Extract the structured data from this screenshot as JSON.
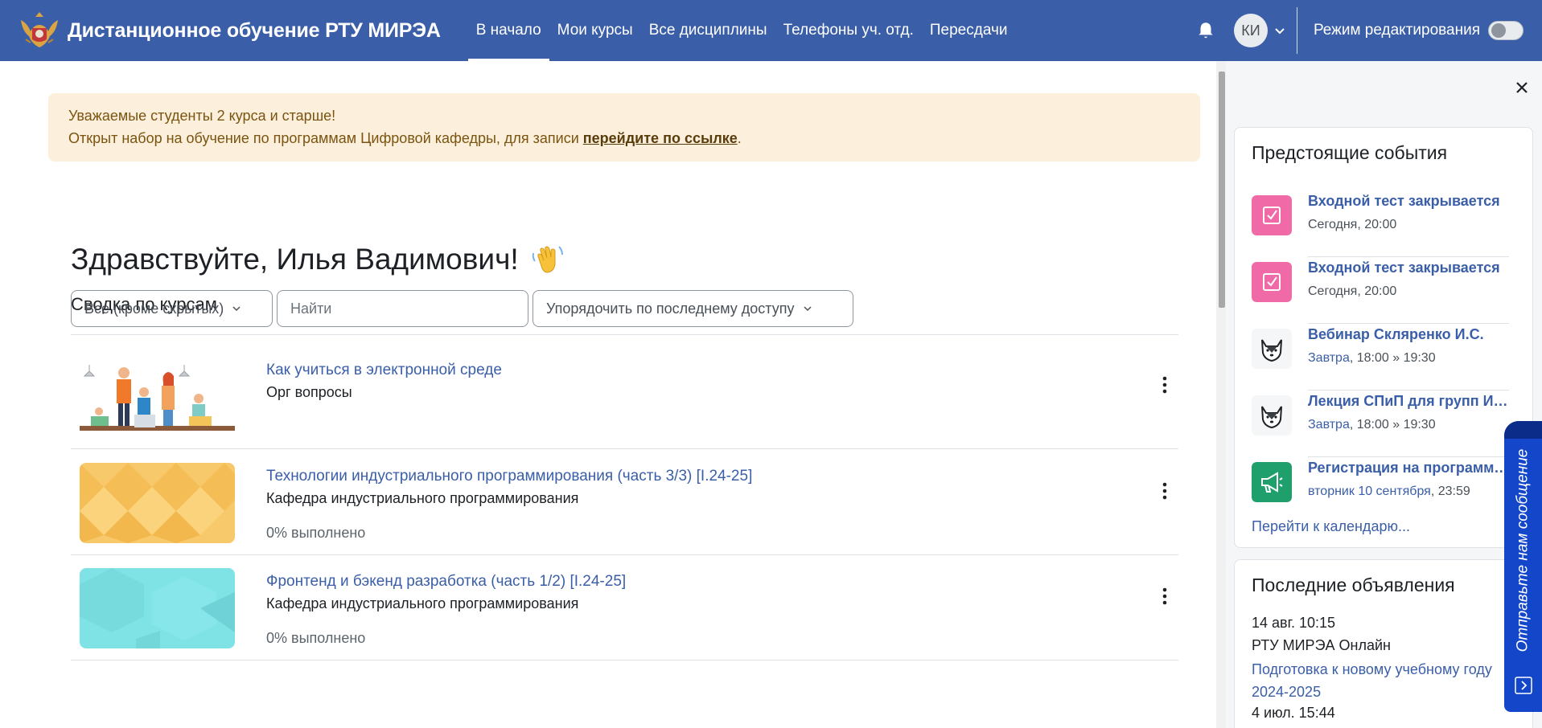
{
  "navbar": {
    "site_title": "Дистанционное обучение РТУ МИРЭА",
    "links": [
      {
        "label": "В начало",
        "active": true
      },
      {
        "label": "Мои курсы",
        "active": false
      },
      {
        "label": "Все дисциплины",
        "active": false
      },
      {
        "label": "Телефоны уч. отд.",
        "active": false
      },
      {
        "label": "Пересдачи",
        "active": false
      }
    ],
    "avatar_initials": "КИ",
    "edit_mode_label": "Режим редактирования",
    "edit_mode_on": false,
    "icons": [
      "bell-icon",
      "chevron-down-icon"
    ]
  },
  "alert": {
    "line1": "Уважаемые студенты 2 курса и старше!",
    "line2_prefix": "Открыт набор на обучение по программам Цифровой кафедры, для записи ",
    "line2_link": "перейдите по ссылке",
    "line2_suffix": "."
  },
  "greeting": {
    "text": "Здравствуйте, Илья Вадимович!",
    "emoji_icon": "waving-hand-icon"
  },
  "overview": {
    "title": "Сводка по курсам",
    "filter_label": "Все (кроме скрытых)",
    "search_placeholder": "Найти",
    "sort_label": "Упорядочить по последнему доступу",
    "courses": [
      {
        "name": "Как учиться в электронной среде",
        "category": "Орг вопросы",
        "progress": "",
        "thumb": "people-illustration"
      },
      {
        "name": "Технологии индустриального программирования (часть 3/3) [I.24-25]",
        "category": "Кафедра индустриального программирования",
        "progress": "0% выполнено",
        "thumb": "pattern-orange"
      },
      {
        "name": "Фронтенд и бэкенд разработка (часть 1/2) [I.24-25]",
        "category": "Кафедра индустриального программирования",
        "progress": "0% выполнено",
        "thumb": "pattern-teal"
      }
    ]
  },
  "upcoming": {
    "title": "Предстоящие события",
    "events": [
      {
        "title": "Входной тест закрывается",
        "date_link": "",
        "date_text": "Сегодня, 20:00",
        "icon": "quiz-icon",
        "color": "#ef6aa6"
      },
      {
        "title": "Входной тест закрывается",
        "date_link": "",
        "date_text": "Сегодня, 20:00",
        "icon": "quiz-icon",
        "color": "#ef6aa6"
      },
      {
        "title": "Вебинар Скляренко И.С.",
        "date_link": "Завтра",
        "date_text": ", 18:00 » 19:30",
        "icon": "husky-icon",
        "color": "#f5f6f7"
      },
      {
        "title": "Лекция СПиП для групп ИКБО-...",
        "date_link": "Завтра",
        "date_text": ", 18:00 » 19:30",
        "icon": "husky-icon",
        "color": "#f5f6f7"
      },
      {
        "title": "Регистрация на программу ...",
        "date_link": "вторник 10 сентября",
        "date_text": ", 23:59",
        "icon": "megaphone-icon",
        "color": "#1e9f6b"
      }
    ],
    "calendar_link": "Перейти к календарю..."
  },
  "announcements": {
    "title": "Последние объявления",
    "date": "14 авг. 10:15",
    "author": "РТУ МИРЭА Онлайн",
    "link": "Подготовка к новому учебному году 2024-2025",
    "more": "4 июл. 15:44"
  },
  "feedback": {
    "label": "Отправьте нам сообщение"
  },
  "colors": {
    "navbar": "#3a5ea8",
    "link": "#3a5ea8",
    "alert_bg": "#fcefdc",
    "feedback": "#1346c9"
  }
}
